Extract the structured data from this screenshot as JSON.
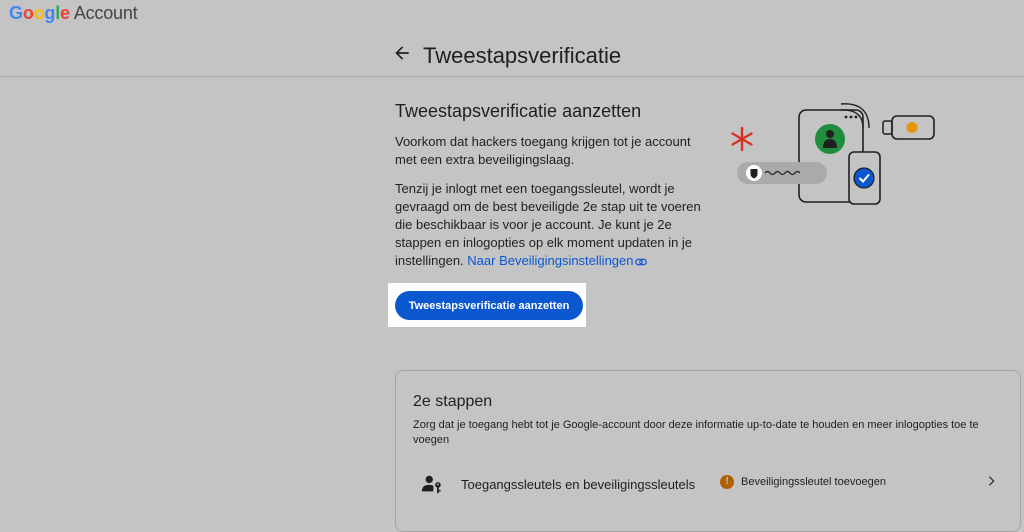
{
  "app": {
    "logo_google": "Google",
    "logo_account": "Account"
  },
  "header": {
    "title": "Tweestapsverificatie"
  },
  "main": {
    "section_title": "Tweestapsverificatie aanzetten",
    "paragraph1": "Voorkom dat hackers toegang krijgen tot je account met een extra beveiligingslaag.",
    "paragraph2": "Tenzij je inlogt met een toegangssleutel, wordt je gevraagd om de best beveiligde 2e stap uit te voeren die beschikbaar is voor je account. Je kunt je 2e stappen en inlogopties op elk moment updaten in je instellingen.",
    "settings_link": "Naar Beveiligingsinstellingen",
    "primary_button": "Tweestapsverificatie aanzetten"
  },
  "second_steps": {
    "title": "2e stappen",
    "description": "Zorg dat je toegang hebt tot je Google-account door deze informatie up-to-date te houden en meer inlogopties toe te voegen",
    "rows": [
      {
        "label": "Toegangssleutels en beveiligingssleutels",
        "status": "Beveiligingssleutel toevoegen",
        "icon": "person-key-icon",
        "status_icon": "warning-icon"
      }
    ]
  },
  "colors": {
    "background": "#c4c4c4",
    "accent": "#0b57d0",
    "warning": "#b06000",
    "google_blue": "#4285F4",
    "google_red": "#EA4335",
    "google_yellow": "#FBBC05",
    "google_green": "#34A853"
  }
}
